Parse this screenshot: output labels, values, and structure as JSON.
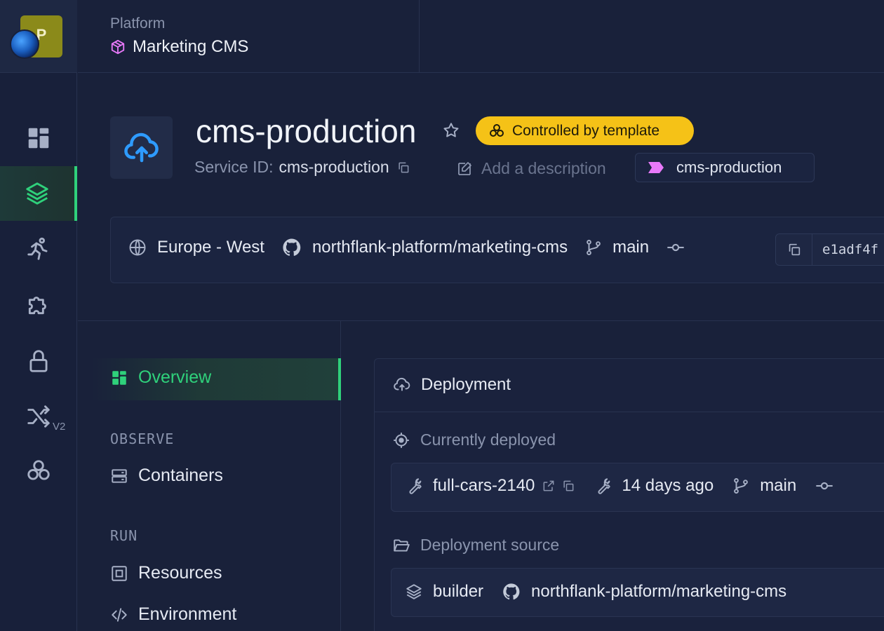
{
  "team": {
    "initial": "P"
  },
  "breadcrumb": {
    "parent": "Platform",
    "project": "Marketing CMS"
  },
  "service": {
    "name": "cms-production",
    "template_badge": "Controlled by template",
    "id_label": "Service ID:",
    "id_value": "cms-production",
    "description_placeholder": "Add a description",
    "tag": "cms-production"
  },
  "info_bar": {
    "region": "Europe - West",
    "repo": "northflank-platform/marketing-cms",
    "branch": "main",
    "commit": "e1adf4f"
  },
  "rail": {
    "v2_label": "V2"
  },
  "subnav": {
    "overview": "Overview",
    "observe_heading": "OBSERVE",
    "containers": "Containers",
    "run_heading": "RUN",
    "resources": "Resources",
    "environment": "Environment"
  },
  "deployment": {
    "title": "Deployment",
    "currently_deployed_label": "Currently deployed",
    "build_name": "full-cars-2140",
    "age": "14 days ago",
    "branch": "main",
    "source_label": "Deployment source",
    "source_type": "builder",
    "source_repo": "northflank-platform/marketing-cms"
  },
  "colors": {
    "accent_green": "#2fd17b",
    "badge_yellow": "#f5c217",
    "tag_pink": "#e879f9",
    "cloud_blue": "#2e9bff"
  }
}
